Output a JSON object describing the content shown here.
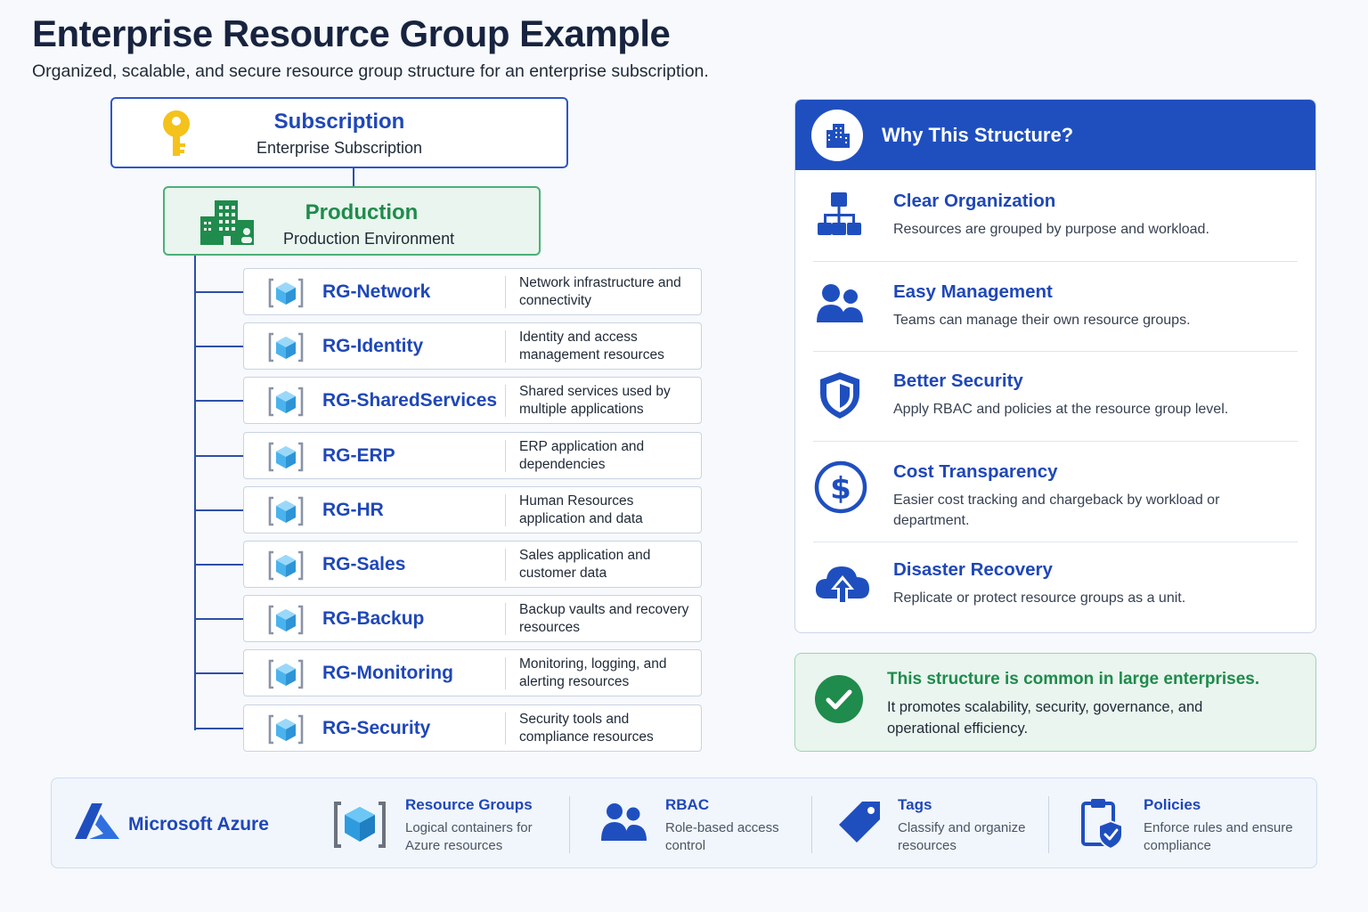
{
  "header": {
    "title": "Enterprise Resource Group Example",
    "subtitle": "Organized, scalable, and secure resource group structure for an enterprise subscription."
  },
  "subscription": {
    "title": "Subscription",
    "subtitle": "Enterprise Subscription",
    "icon": "key-icon",
    "color": "#2f55c9"
  },
  "production": {
    "title": "Production",
    "subtitle": "Production Environment",
    "icon": "building-icon",
    "color": "#1f8b4c"
  },
  "resource_groups": [
    {
      "name": "RG-Network",
      "description": "Network infrastructure and connectivity"
    },
    {
      "name": "RG-Identity",
      "description": "Identity and access management resources"
    },
    {
      "name": "RG-SharedServices",
      "description": "Shared services used by multiple applications"
    },
    {
      "name": "RG-ERP",
      "description": "ERP application and dependencies"
    },
    {
      "name": "RG-HR",
      "description": "Human Resources application and data"
    },
    {
      "name": "RG-Sales",
      "description": "Sales application and customer data"
    },
    {
      "name": "RG-Backup",
      "description": "Backup vaults and recovery resources"
    },
    {
      "name": "RG-Monitoring",
      "description": "Monitoring, logging, and alerting resources"
    },
    {
      "name": "RG-Security",
      "description": "Security tools and compliance resources"
    }
  ],
  "why": {
    "title": "Why This Structure?",
    "items": [
      {
        "icon": "hierarchy-icon",
        "title": "Clear Organization",
        "text": "Resources are grouped by purpose and workload."
      },
      {
        "icon": "people-icon",
        "title": "Easy Management",
        "text": "Teams can manage their own resource groups."
      },
      {
        "icon": "shield-icon",
        "title": "Better Security",
        "text": "Apply RBAC and policies at the resource group level."
      },
      {
        "icon": "dollar-icon",
        "title": "Cost Transparency",
        "text": "Easier cost tracking and chargeback by workload or department."
      },
      {
        "icon": "cloud-recovery-icon",
        "title": "Disaster Recovery",
        "text": "Replicate or protect resource groups as a unit."
      }
    ]
  },
  "callout": {
    "title": "This structure is common in large enterprises.",
    "text": "It promotes scalability, security, governance, and operational efficiency.",
    "color": "#1f8b4c"
  },
  "footer": {
    "brand": "Microsoft Azure",
    "items": [
      {
        "icon": "cube-icon",
        "title": "Resource Groups",
        "text": "Logical containers for Azure resources"
      },
      {
        "icon": "people-icon",
        "title": "RBAC",
        "text": "Role-based access control"
      },
      {
        "icon": "tag-icon",
        "title": "Tags",
        "text": "Classify and organize resources"
      },
      {
        "icon": "clipboard-shield-icon",
        "title": "Policies",
        "text": "Enforce rules and ensure compliance"
      }
    ]
  }
}
